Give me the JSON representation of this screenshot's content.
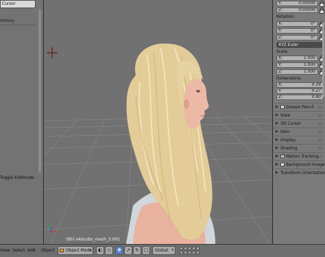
{
  "left_panel": {
    "top_field": "Cursor",
    "history_label": "History",
    "bottom_label": "Toggle Editmode"
  },
  "viewport": {
    "status_text": "(89) s4studio_mesh_3.001",
    "colors": {
      "background": "#717171",
      "grid": "#8a8a8a",
      "hair": "#e6cf9c",
      "skin": "#e9b5a3",
      "shirt": "#d3d9dc"
    }
  },
  "right_panel": {
    "location_rows": [
      {
        "axis": "Y:",
        "value": "0.00000"
      },
      {
        "axis": "Z:",
        "value": "0.00000"
      }
    ],
    "rotation_label": "Rotation:",
    "rotation_rows": [
      {
        "axis": "X:",
        "value": "0°"
      },
      {
        "axis": "Y:",
        "value": "0°"
      },
      {
        "axis": "Z:",
        "value": "0°"
      }
    ],
    "rotation_mode": "XYZ Euler",
    "scale_label": "Scale:",
    "scale_rows": [
      {
        "axis": "X:",
        "value": "1.000"
      },
      {
        "axis": "Y:",
        "value": "1.000"
      },
      {
        "axis": "Z:",
        "value": "1.000"
      }
    ],
    "dimensions_label": "Dimensions:",
    "dimension_rows": [
      {
        "axis": "X:",
        "value": "0.29"
      },
      {
        "axis": "Y:",
        "value": "0.27"
      },
      {
        "axis": "Z:",
        "value": "0.40"
      }
    ],
    "panels": [
      {
        "label": "Grease Pencil",
        "checkbox": false
      },
      {
        "label": "View",
        "checkbox": false
      },
      {
        "label": "3D Cursor",
        "checkbox": false
      },
      {
        "label": "Item",
        "checkbox": false
      },
      {
        "label": "Display",
        "checkbox": false
      },
      {
        "label": "Shading",
        "checkbox": false
      },
      {
        "label": "Motion Tracking",
        "checkbox": true,
        "checked": true
      },
      {
        "label": "Background Images",
        "checkbox": true,
        "checked": false
      },
      {
        "label": "Transform Orientations",
        "checkbox": false
      }
    ]
  },
  "header": {
    "menus": [
      "View",
      "Select",
      "Add",
      "Object"
    ],
    "mode": "Object Mode",
    "transform_space": "Global"
  }
}
